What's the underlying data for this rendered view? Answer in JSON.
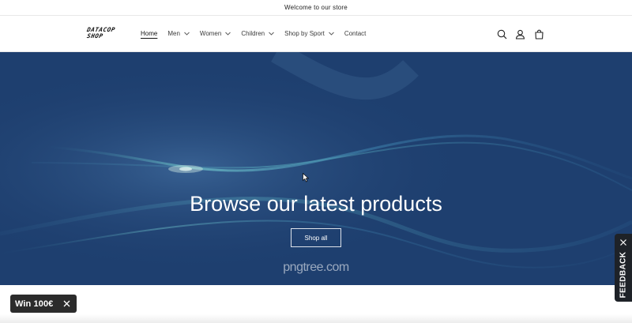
{
  "announcement": {
    "text": "Welcome to our store"
  },
  "header": {
    "logo_line1": "DATACOP",
    "logo_line2": "SHOP",
    "nav": [
      {
        "label": "Home",
        "active": true,
        "dropdown": false
      },
      {
        "label": "Men",
        "dropdown": true
      },
      {
        "label": "Women",
        "dropdown": true
      },
      {
        "label": "Children",
        "dropdown": true
      },
      {
        "label": "Shop by Sport",
        "dropdown": true
      },
      {
        "label": "Contact",
        "dropdown": false
      }
    ],
    "icons": [
      "search-icon",
      "account-icon",
      "cart-icon"
    ]
  },
  "hero": {
    "title": "Browse our latest products",
    "button_label": "Shop all",
    "watermark": "pngtree.com",
    "background_color": "#1e3f6f"
  },
  "widgets": {
    "win_label": "Win 100€",
    "feedback_label": "FEEDBACK"
  },
  "colors": {
    "text": "#121212",
    "hero_bg": "#1e3f6f",
    "badge_bg": "#2b2b2b",
    "feedback_bg": "#1e2228"
  }
}
